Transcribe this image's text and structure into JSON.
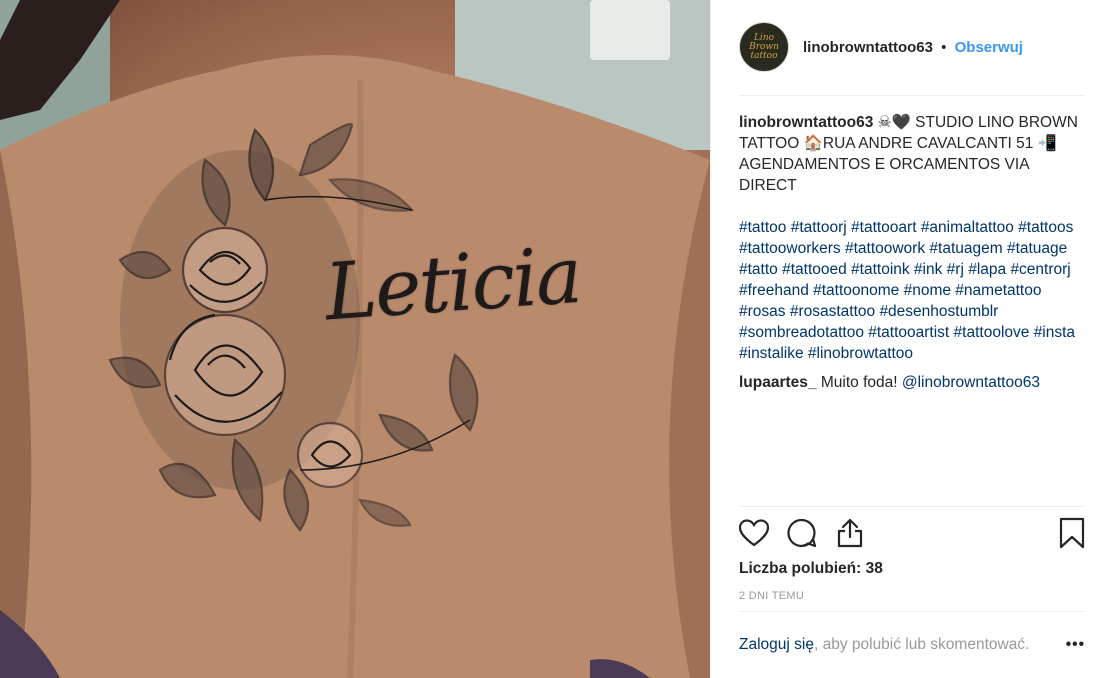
{
  "photo": {
    "tattoo_text": "Leticia"
  },
  "post": {
    "author": "linobrowntattoo63",
    "separator": "•",
    "follow_label": "Obserwuj",
    "avatar_text": "Lino Brown tattoo",
    "caption_author": "linobrowntattoo63",
    "caption_text": "☠🖤 STUDIO LINO BROWN TATTOO 🏠RUA ANDRE CAVALCANTI 51 📲AGENDAMENTOS E ORCAMENTOS VIA DIRECT",
    "hashtags": "#tattoo #tattoorj #tattooart #animaltattoo #tattoos #tattooworkers #tattoowork #tatuagem #tatuage #tatto #tattooed #tattoink #ink #rj #lapa #centrorj #freehand #tattoonome #nome #nametattoo #rosas #rosastattoo #desenhostumblr #sombreadotattoo #tattooartist #tattoolove #insta #instalike #linobrowtattoo",
    "comment": {
      "user": "lupaartes_",
      "text": "Muito foda!",
      "mention": "@linobrowntattoo63"
    },
    "likes": "Liczba polubień: 38",
    "time": "2 DNI TEMU",
    "login_link": "Zaloguj się",
    "login_rest": ", aby polubić lub skomentować.",
    "more": "•••"
  },
  "icons": [
    "heart-icon",
    "comment-icon",
    "share-icon",
    "bookmark-icon"
  ]
}
